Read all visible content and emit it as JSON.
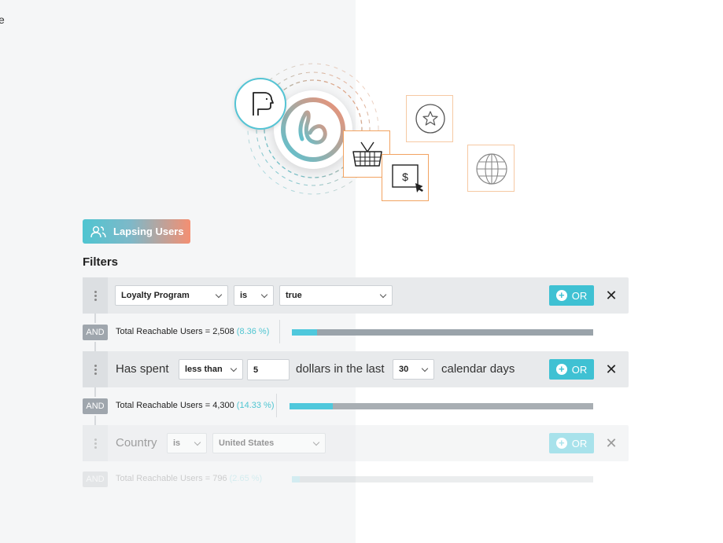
{
  "stray_text": "e",
  "segment": {
    "label": "Lapsing Users",
    "icon": "users-icon"
  },
  "filters_title": "Filters",
  "filters": [
    {
      "type": "dropdowns",
      "field": "Loyalty Program",
      "operator": "is",
      "value": "true",
      "or_label": "OR",
      "reachable": {
        "label": "Total Reachable Users = 2,508",
        "pct": "(8.36 %)",
        "fraction": 0.0836
      }
    },
    {
      "type": "sentence",
      "prefix": "Has spent",
      "operator": "less than",
      "amount": "5",
      "middle": "dollars in the last",
      "days": "30",
      "suffix": "calendar days",
      "or_label": "OR",
      "reachable": {
        "label": "Total Reachable Users = 4,300",
        "pct": "(14.33 %)",
        "fraction": 0.1433
      }
    },
    {
      "type": "dropdowns",
      "field": "Country",
      "operator": "is",
      "value": "United States",
      "or_label": "OR",
      "reachable": {
        "label": "Total Reachable Users = 796",
        "pct": "(2.65 %)",
        "fraction": 0.0265
      }
    }
  ],
  "and_label": "AND",
  "colors": {
    "accent": "#3fc1d3",
    "orange": "#f2a361",
    "gradient_start": "#4fc5d1",
    "gradient_end": "#f48f72"
  },
  "illustration_icons": [
    "p-logo-icon",
    "b-logo-icon",
    "basket-icon",
    "dollar-cursor-icon",
    "star-icon",
    "globe-icon"
  ]
}
